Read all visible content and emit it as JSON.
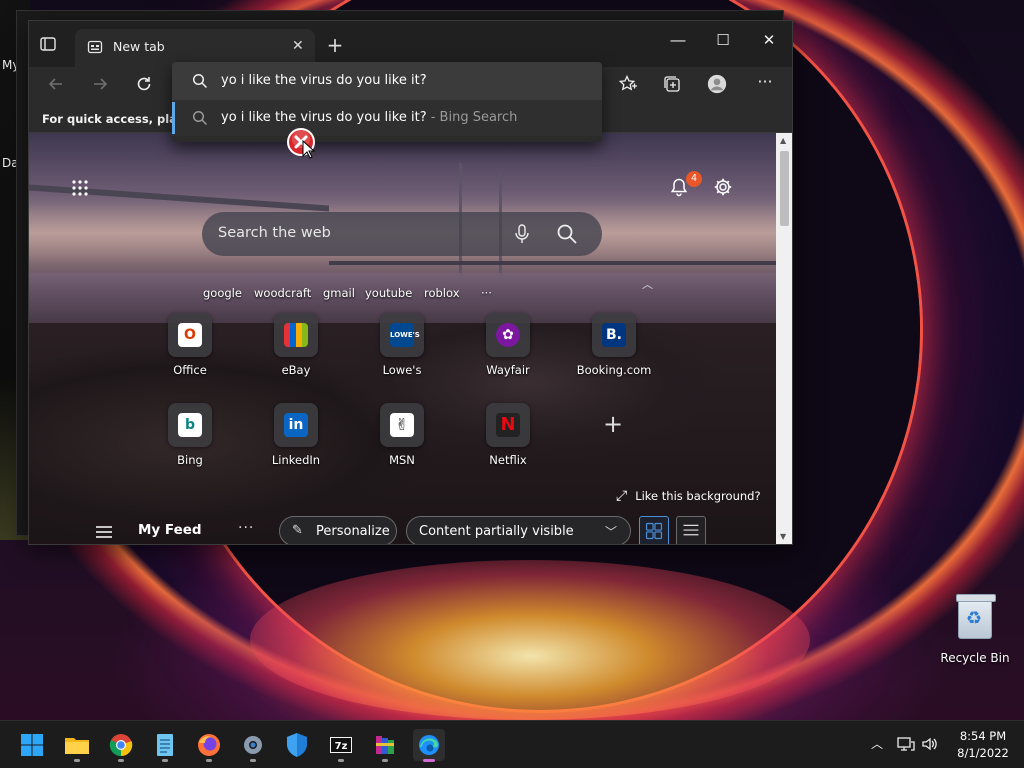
{
  "desktop": {
    "left_labels": [
      "My",
      "Da"
    ],
    "recycle_bin_label": "Recycle Bin"
  },
  "browser": {
    "tab": {
      "title": "New tab"
    },
    "favorites_hint": "For quick access, place y",
    "omnibox": {
      "query": "yo i like the virus do you like it?",
      "suggestion": "yo i like the virus do you like it?",
      "suggestion_source": " - Bing Search"
    }
  },
  "newtab": {
    "notification_count": "4",
    "search_placeholder": "Search the web",
    "quick_links": [
      "google",
      "woodcraft",
      "gmail",
      "youtube",
      "roblox",
      "···"
    ],
    "tiles": [
      {
        "label": "Office",
        "icon": "office-icon",
        "color": "#d83b01"
      },
      {
        "label": "eBay",
        "icon": "ebay-icon",
        "color": "#e53238"
      },
      {
        "label": "Lowe's",
        "icon": "lowes-icon",
        "color": "#004990"
      },
      {
        "label": "Wayfair",
        "icon": "wayfair-icon",
        "color": "#7b189f"
      },
      {
        "label": "Booking.com",
        "icon": "booking-icon",
        "color": "#003580"
      },
      {
        "label": "Bing",
        "icon": "bing-icon",
        "color": "#0c8484"
      },
      {
        "label": "LinkedIn",
        "icon": "linkedin-icon",
        "color": "#0a66c2"
      },
      {
        "label": "MSN",
        "icon": "msn-icon",
        "color": "#ffffff"
      },
      {
        "label": "Netflix",
        "icon": "netflix-icon",
        "color": "#e50914"
      }
    ],
    "like_background": "Like this background?",
    "feed": {
      "title": "My Feed",
      "personalize": "Personalize",
      "content_visibility": "Content partially visible"
    }
  },
  "taskbar": {
    "apps": [
      "start",
      "file-explorer",
      "chrome",
      "notepad",
      "firefox",
      "settings",
      "windows-security",
      "7-zip",
      "winrar",
      "edge"
    ],
    "time": "8:54 PM",
    "date": "8/1/2022"
  }
}
